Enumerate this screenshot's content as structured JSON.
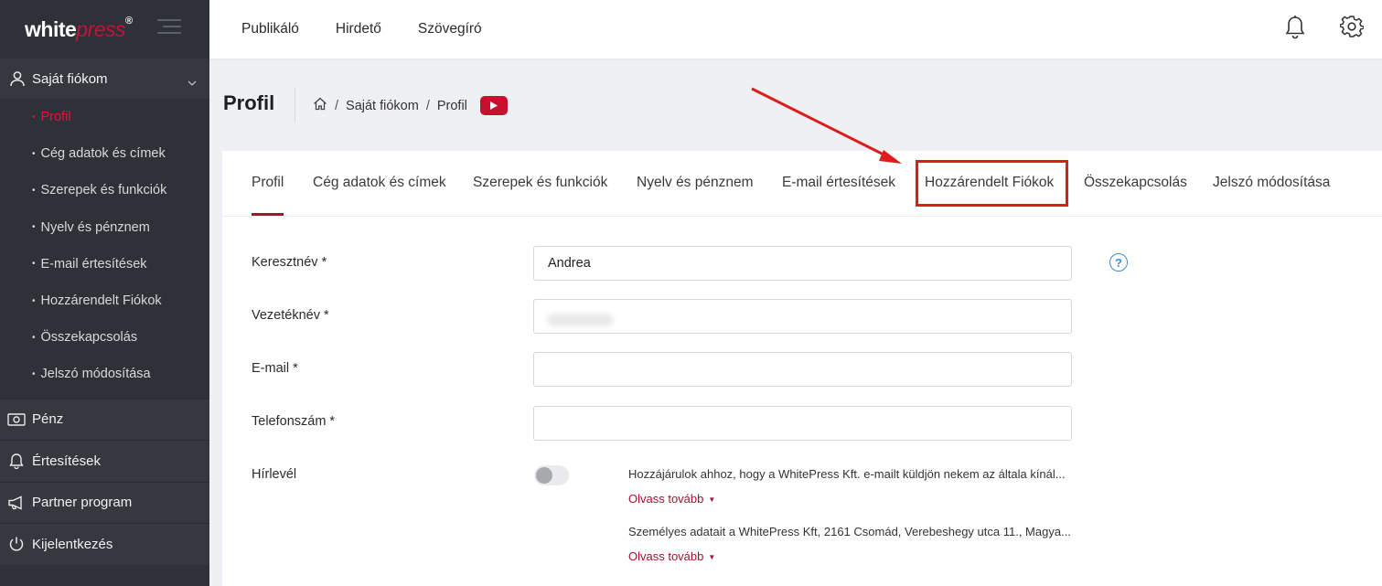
{
  "brand": {
    "logo_white": "white",
    "logo_accent": "press",
    "logo_reg": "®"
  },
  "topnav": {
    "items": [
      "Publikáló",
      "Hirdető",
      "Szövegíró"
    ]
  },
  "sidebar": {
    "section": "Saját fiókom",
    "subitems": [
      "Profil",
      "Cég adatok és címek",
      "Szerepek és funkciók",
      "Nyelv és pénznem",
      "E-mail értesítések",
      "Hozzárendelt Fiókok",
      "Összekapcsolás",
      "Jelszó módosítása"
    ],
    "main_items": [
      "Pénz",
      "Értesítések",
      "Partner program",
      "Kijelentkezés"
    ],
    "bullet": "•"
  },
  "page": {
    "title": "Profil",
    "breadcrumb": [
      "Saját fiókom",
      "Profil"
    ],
    "breadcrumb_sep": "/"
  },
  "tabs": [
    "Profil",
    "Cég adatok és címek",
    "Szerepek és funkciók",
    "Nyelv és pénznem",
    "E-mail értesítések",
    "Hozzárendelt Fiókok",
    "Összekapcsolás",
    "Jelszó módosítása"
  ],
  "form": {
    "first_name_label": "Keresztnév *",
    "first_name_value": "Andrea",
    "last_name_label": "Vezetéknév *",
    "email_label": "E-mail *",
    "phone_label": "Telefonszám *",
    "newsletter_label": "Hírlevél",
    "help": "?",
    "consent_1": "Hozzájárulok ahhoz, hogy a WhitePress Kft. e-mailt küldjön nekem az általa kínál...",
    "consent_2": "Személyes adatait a WhitePress Kft, 2161 Csomád, Verebeshegy utca 11., Magya...",
    "read_more": "Olvass tovább",
    "caret": "▼"
  },
  "colors": {
    "accent": "#a8122d",
    "sidebar_bg": "#2e3137",
    "annotation": "#e01b1b",
    "link_blue": "#3a8ed8"
  },
  "icons": [
    "user-icon",
    "chevron-down-icon",
    "money-icon",
    "bell-icon",
    "megaphone-icon",
    "power-icon",
    "home-icon",
    "youtube-icon",
    "gear-icon",
    "help-icon",
    "hamburger-icon"
  ]
}
